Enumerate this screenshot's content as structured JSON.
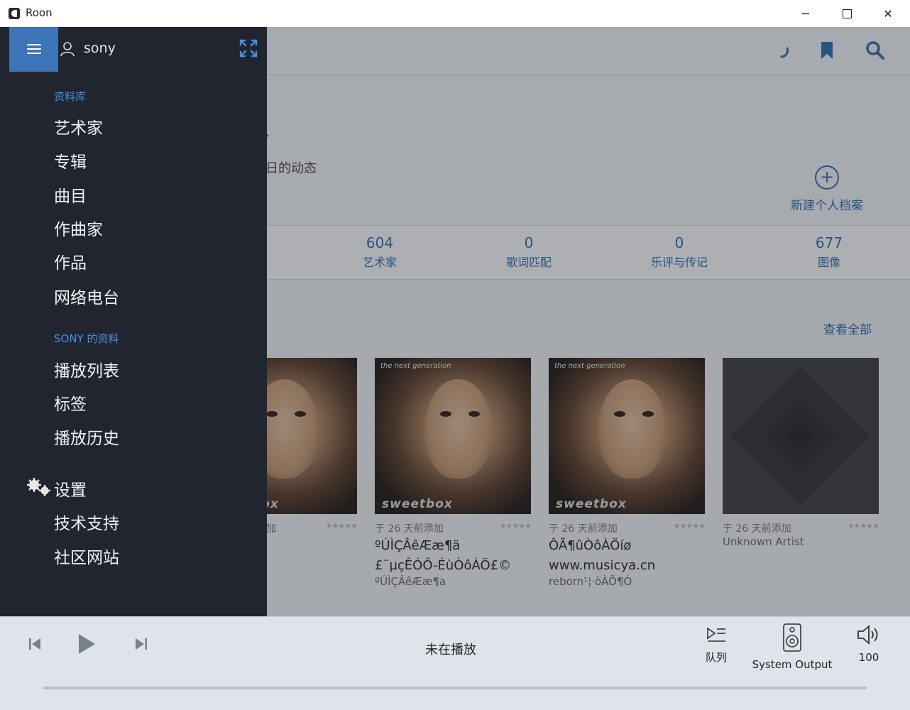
{
  "window": {
    "title": "Roon",
    "min": "─",
    "close": "✕"
  },
  "sidebar": {
    "username": "sony",
    "library_label": "资料库",
    "library_items": [
      "艺术家",
      "专辑",
      "曲目",
      "作曲家",
      "作品",
      "网络电台"
    ],
    "profile_label": "SONY 的资料",
    "profile_items": [
      "播放列表",
      "标签",
      "播放历史"
    ],
    "settings": "设置",
    "support": "技术支持",
    "community": "社区网站"
  },
  "hero": {
    "title": "ony",
    "subtitle": "科库今日的动态",
    "new_profile": "新建个人档案"
  },
  "stats": [
    {
      "value": "604",
      "label": "艺术家"
    },
    {
      "value": "0",
      "label": "歌词匹配"
    },
    {
      "value": "0",
      "label": "乐评与传记"
    },
    {
      "value": "677",
      "label": "图像"
    }
  ],
  "section": {
    "view_all": "查看全部"
  },
  "albums": [
    {
      "added": "加",
      "title": "",
      "title2": "",
      "artist": "",
      "cover_top": "",
      "cover_bot": "sweetbox"
    },
    {
      "added": "于 26 天前添加",
      "title": "ºÚÌÇÂêÆæ¶ä",
      "title2": "£¨µçÊÓÔ-ÉùÒôÀÖ£©",
      "artist": "ºÚÌÇÂêÆæ¶a",
      "cover_top": "the next generation",
      "cover_bot": "sweetbox"
    },
    {
      "added": "于 26 天前添加",
      "title": "ÔÃ¶ûÒôÀÖíø",
      "title2": "www.musicya.cn",
      "artist": "reborn¹¦·òÀÖ¶Ó",
      "cover_top": "the next generation",
      "cover_bot": "sweetbox"
    },
    {
      "added": "于 26 天前添加",
      "title": "Unknown Artist",
      "title2": "",
      "artist": "",
      "cover_top": "",
      "cover_bot": ""
    }
  ],
  "stars": "★★★★★",
  "player": {
    "now_playing": "未在播放",
    "queue": "队列",
    "output": "System Output",
    "volume": "100"
  },
  "icons": {
    "menu": "hamburger-icon",
    "user": "user-icon",
    "expand": "expand-icon",
    "settings": "gear-icon",
    "bookmark": "bookmark-icon",
    "search": "search-icon",
    "spinner": "loading-spinner-icon",
    "prev": "previous-track-icon",
    "play": "play-icon",
    "next": "next-track-icon",
    "queue": "queue-icon",
    "speaker": "speaker-icon",
    "volume": "volume-icon"
  },
  "colors": {
    "accent": "#3d73b7",
    "link": "#2b6cb0",
    "sidebar_bg": "#212530",
    "section_label": "#4a90e2"
  }
}
